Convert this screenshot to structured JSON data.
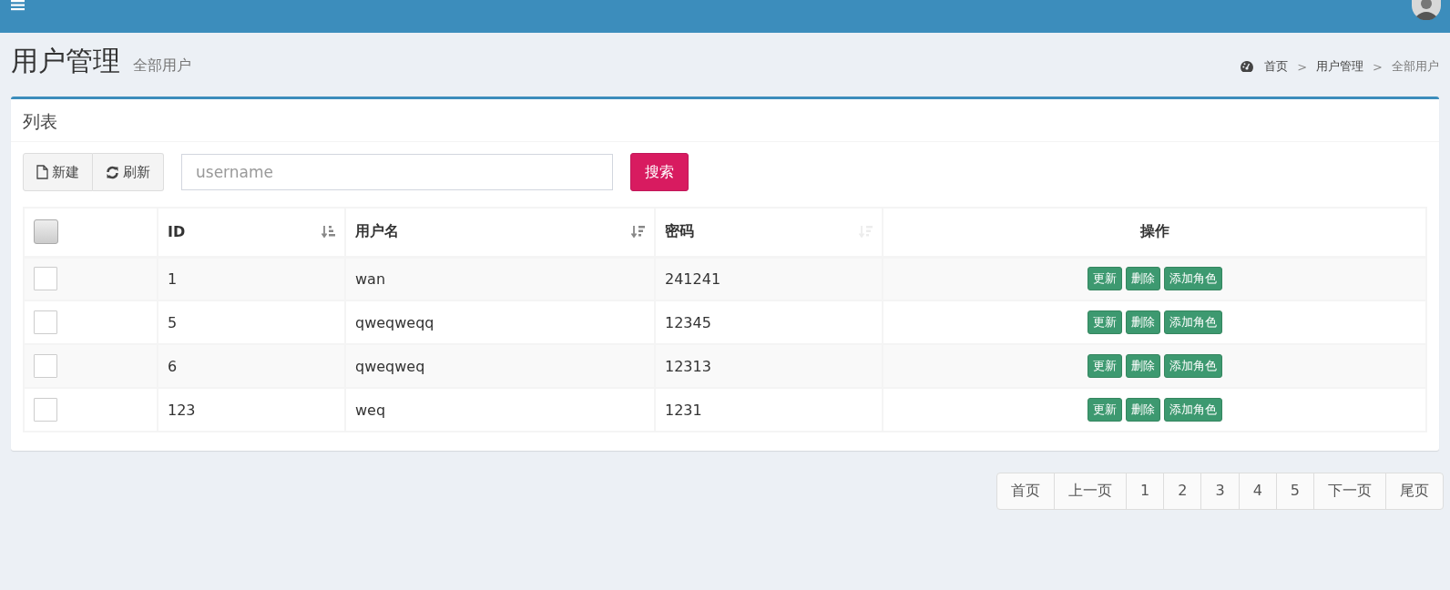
{
  "page_header": {
    "title": "用户管理",
    "subtitle": "全部用户"
  },
  "breadcrumb": [
    {
      "label": "首页"
    },
    {
      "separator": ">",
      "label": "用户管理"
    },
    {
      "separator": ">",
      "label": "全部用户"
    }
  ],
  "box": {
    "title": "列表",
    "toolbar": {
      "buttons": [
        {
          "kind": "new",
          "label": "新建"
        },
        {
          "kind": "refresh",
          "label": "刷新"
        }
      ],
      "search": {
        "placeholder": "username"
      },
      "search_button": "搜索"
    },
    "table": {
      "select_all": {
        "checked": false
      },
      "columns": [
        {
          "label": "ID",
          "sorted": true,
          "ascending": true
        },
        {
          "label": "用户名",
          "sorted": true,
          "ascending": false
        },
        {
          "label": "密码",
          "sorted": false,
          "ascending": false
        },
        {
          "label": "操作"
        }
      ],
      "rows": [
        {
          "checked": false,
          "cells": [
            "1",
            "wan",
            "241241"
          ],
          "actions": [
            "更新",
            "删除",
            "添加角色"
          ]
        },
        {
          "checked": false,
          "cells": [
            "5",
            "qweqweqq",
            "12345"
          ],
          "actions": [
            "更新",
            "删除",
            "添加角色"
          ]
        },
        {
          "checked": false,
          "cells": [
            "6",
            "qweqweq",
            "12313"
          ],
          "actions": [
            "更新",
            "删除",
            "添加角色"
          ]
        },
        {
          "checked": false,
          "cells": [
            "123",
            "weq",
            "1231"
          ],
          "actions": [
            "更新",
            "删除",
            "添加角色"
          ]
        }
      ]
    }
  },
  "pagination": [
    "首页",
    "上一页",
    "1",
    "2",
    "3",
    "4",
    "5",
    "下一页",
    "尾页"
  ]
}
